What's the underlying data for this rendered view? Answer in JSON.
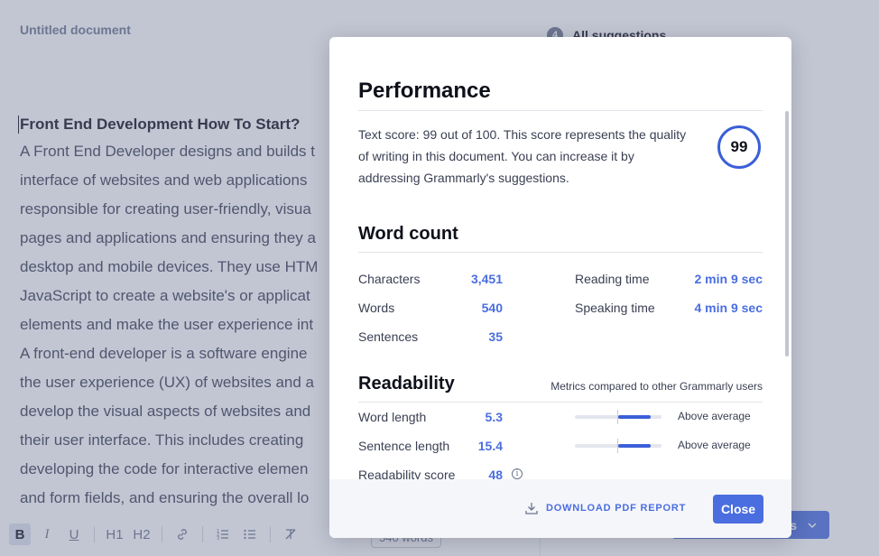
{
  "editor": {
    "doc_title": "Untitled document",
    "suggestions_count": "4",
    "suggestions_label": "All suggestions",
    "heading": "Front End Development How To Start?",
    "lines": [
      "A Front End Developer designs and builds t",
      "interface of websites and web applications",
      "responsible for creating user-friendly, visua",
      "pages and applications and ensuring they a",
      "desktop and mobile devices. They use HTM",
      "JavaScript to create a website's or applicat",
      "elements and make the user experience int",
      "A front-end developer is a software engine",
      "the user experience (UX) of websites and a",
      "develop the visual aspects of websites and",
      "their user interface. This includes creating",
      "developing the code for interactive elemen",
      "and form fields, and ensuring the overall lo"
    ],
    "toolbar": {
      "bold": "B",
      "italic": "I",
      "underline": "U",
      "h1": "H1",
      "h2": "H2"
    },
    "word_count_pill": "540 words",
    "bottom_button_label": "ns"
  },
  "modal": {
    "title": "Performance",
    "score_text": "Text score: 99 out of 100. This score represents the quality of writing in this document. You can increase it by addressing Grammarly's suggestions.",
    "score": "99",
    "word_count": {
      "title": "Word count",
      "left": [
        {
          "label": "Characters",
          "value": "3,451"
        },
        {
          "label": "Words",
          "value": "540"
        },
        {
          "label": "Sentences",
          "value": "35"
        }
      ],
      "right": [
        {
          "label": "Reading time",
          "value": "2 min 9 sec"
        },
        {
          "label": "Speaking time",
          "value": "4 min 9 sec"
        }
      ]
    },
    "readability": {
      "title": "Readability",
      "note": "Metrics compared to other Grammarly users",
      "metrics": [
        {
          "label": "Word length",
          "value": "5.3",
          "comparison": "Above average",
          "level_start": 0.5,
          "level_end": 0.88
        },
        {
          "label": "Sentence length",
          "value": "15.4",
          "comparison": "Above average",
          "level_start": 0.5,
          "level_end": 0.88
        },
        {
          "label": "Readability score",
          "value": "48"
        }
      ]
    },
    "footer": {
      "download_label": "DOWNLOAD PDF REPORT",
      "close_label": "Close"
    },
    "colors": {
      "accent": "#4a6ee0",
      "ring": "#3b5fd9"
    }
  }
}
